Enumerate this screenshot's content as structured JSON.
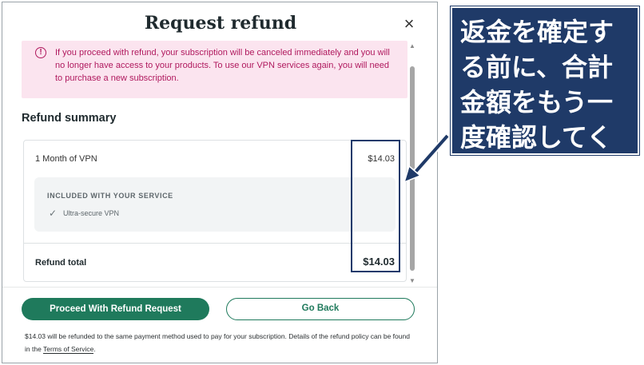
{
  "modal": {
    "title": "Request refund",
    "close_label": "×"
  },
  "alert": {
    "icon": "!",
    "text": "If you proceed with refund, your subscription will be canceled immediately and you will no longer have access to your products. To use our VPN services again, you will need to purchase a new subscription."
  },
  "summary": {
    "heading": "Refund summary",
    "item_name": "1 Month of VPN",
    "item_price": "$14.03",
    "included_title": "INCLUDED WITH YOUR SERVICE",
    "included_feature": "Ultra-secure VPN",
    "total_label": "Refund total",
    "total_price": "$14.03"
  },
  "footer": {
    "proceed_label": "Proceed With Refund Request",
    "back_label": "Go Back",
    "note_prefix": "$14.03 will be refunded to the same payment method used to pay for your subscription. Details of the refund policy can be found in the ",
    "tos_link": "Terms of Service",
    "note_suffix": "."
  },
  "callout": {
    "text": "返金を確定する前に、合計金額をもう一度確認してください 😄"
  },
  "colors": {
    "primary_green": "#1f7a5c",
    "alert_bg": "#fbe4ef",
    "alert_text": "#b0195e",
    "callout_bg": "#1f3a68"
  }
}
